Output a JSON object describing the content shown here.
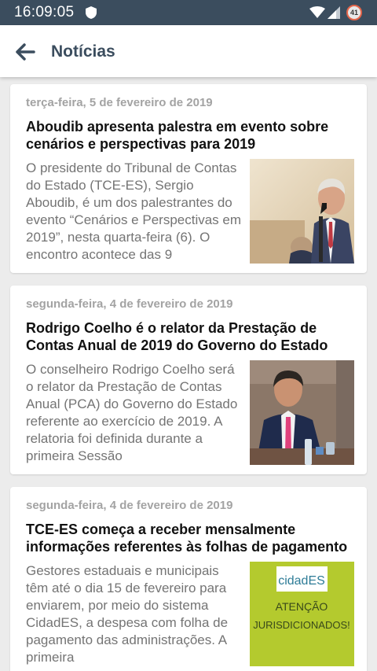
{
  "status": {
    "time": "16:09:05",
    "battery_level": "41"
  },
  "appbar": {
    "title": "Notícias"
  },
  "news": [
    {
      "date": "terça-feira, 5 de fevereiro de 2019",
      "title": "Aboudib apresenta palestra em evento sobre cenários e perspectivas para 2019",
      "summary": "O presidente do Tribunal de Contas do Estado (TCE-ES), Sergio Aboudib, é um dos palestrantes do evento “Cenários e Perspectivas em 2019”, nesta quarta-feira (6). O encontro acontece das 9"
    },
    {
      "date": "segunda-feira, 4 de fevereiro de 2019",
      "title": "Rodrigo Coelho é o relator da Prestação de Contas Anual de 2019 do Governo do Estado",
      "summary": "O conselheiro Rodrigo Coelho será o relator da Prestação de Contas Anual (PCA) do Governo do Estado referente ao exercício de 2019. A relatoria foi definida durante a primeira Sessão"
    },
    {
      "date": "segunda-feira, 4 de fevereiro de 2019",
      "title": "TCE-ES começa a receber mensalmente informações referentes às folhas de pagamento",
      "summary": "Gestores estaduais e municipais têm até o dia 15 de fevereiro para enviarem, por meio do sistema CidadES, a despesa com folha de pagamento das administrações. A primeira",
      "image_logo": "cidadES",
      "image_line1": "ATENÇÃO",
      "image_line2": "JURISDICIONADOS!"
    }
  ]
}
